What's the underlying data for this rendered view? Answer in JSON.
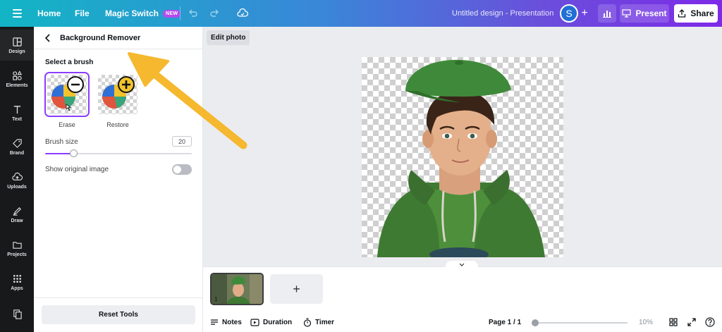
{
  "topbar": {
    "home": "Home",
    "file": "File",
    "magic_switch": "Magic Switch",
    "new_badge": "NEW",
    "design_title": "Untitled design - Presentation",
    "avatar_letter": "S",
    "present": "Present",
    "share": "Share"
  },
  "rail": {
    "items": [
      {
        "label": "Design",
        "icon": "design-icon"
      },
      {
        "label": "Elements",
        "icon": "elements-icon"
      },
      {
        "label": "Text",
        "icon": "text-icon"
      },
      {
        "label": "Brand",
        "icon": "brand-icon"
      },
      {
        "label": "Uploads",
        "icon": "uploads-icon"
      },
      {
        "label": "Draw",
        "icon": "draw-icon"
      },
      {
        "label": "Projects",
        "icon": "projects-icon"
      },
      {
        "label": "Apps",
        "icon": "apps-icon"
      }
    ]
  },
  "panel": {
    "title": "Background Remover",
    "brush_section": "Select a brush",
    "erase_label": "Erase",
    "restore_label": "Restore",
    "brush_size_label": "Brush size",
    "brush_size_value": "20",
    "brush_size_fraction": 0.19,
    "show_original_label": "Show original image",
    "show_original_on": false,
    "reset_label": "Reset Tools"
  },
  "toolbar": {
    "edit_photo": "Edit photo"
  },
  "pages": {
    "thumb_number": "1",
    "add_page": "+"
  },
  "footer": {
    "notes": "Notes",
    "duration": "Duration",
    "timer": "Timer",
    "page_indicator": "Page 1 / 1",
    "zoom": "10%",
    "zoom_fraction": 0.0
  },
  "colors": {
    "accent": "#8b3dff",
    "annotation_arrow": "#f5b82e"
  }
}
